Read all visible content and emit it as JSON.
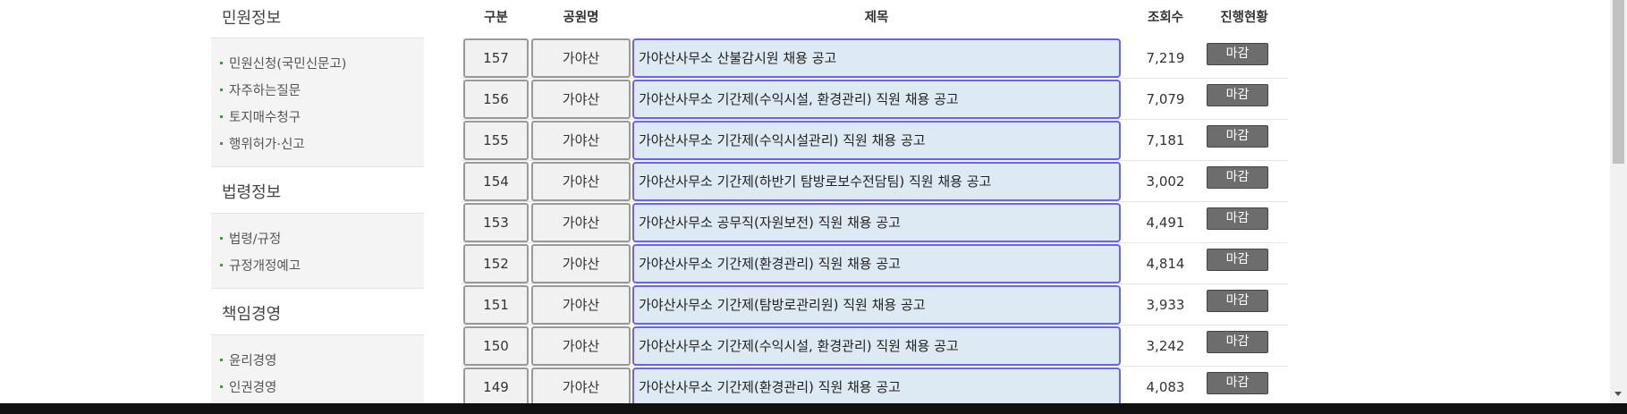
{
  "sidebar": {
    "sections": [
      {
        "title": "민원정보",
        "items": [
          "민원신청(국민신문고)",
          "자주하는질문",
          "토지매수청구",
          "행위허가·신고"
        ]
      },
      {
        "title": "법령정보",
        "items": [
          "법령/규정",
          "규정개정예고"
        ]
      },
      {
        "title": "책임경영",
        "items": [
          "윤리경영",
          "인권경영"
        ]
      }
    ]
  },
  "table": {
    "headers": {
      "num": "구분",
      "park": "공원명",
      "title": "제목",
      "views": "조회수",
      "status": "진행현황"
    },
    "rows": [
      {
        "num": "157",
        "park": "가야산",
        "title": "가야산사무소 산불감시원 채용 공고",
        "views": "7,219",
        "status": "마감"
      },
      {
        "num": "156",
        "park": "가야산",
        "title": "가야산사무소 기간제(수익시설, 환경관리) 직원 채용 공고",
        "views": "7,079",
        "status": "마감"
      },
      {
        "num": "155",
        "park": "가야산",
        "title": "가야산사무소 기간제(수익시설관리) 직원 채용 공고",
        "views": "7,181",
        "status": "마감"
      },
      {
        "num": "154",
        "park": "가야산",
        "title": "가야산사무소 기간제(하반기 탐방로보수전담팀) 직원 채용 공고",
        "views": "3,002",
        "status": "마감"
      },
      {
        "num": "153",
        "park": "가야산",
        "title": "가야산사무소 공무직(자원보전) 직원 채용 공고",
        "views": "4,491",
        "status": "마감"
      },
      {
        "num": "152",
        "park": "가야산",
        "title": "가야산사무소 기간제(환경관리) 직원 채용 공고",
        "views": "4,814",
        "status": "마감"
      },
      {
        "num": "151",
        "park": "가야산",
        "title": "가야산사무소 기간제(탐방로관리원) 직원 채용 공고",
        "views": "3,933",
        "status": "마감"
      },
      {
        "num": "150",
        "park": "가야산",
        "title": "가야산사무소 기간제(수익시설, 환경관리) 직원 채용 공고",
        "views": "3,242",
        "status": "마감"
      },
      {
        "num": "149",
        "park": "가야산",
        "title": "가야산사무소 기간제(환경관리) 직원 채용 공고",
        "views": "4,083",
        "status": "마감"
      }
    ]
  },
  "colors": {
    "accent_green": "#3f9a3c",
    "title_highlight": "#dde9f3",
    "title_border": "#6b64e6",
    "badge": "#6d6d6d"
  },
  "icons": {
    "scroll_down": "triangle-down-icon"
  }
}
